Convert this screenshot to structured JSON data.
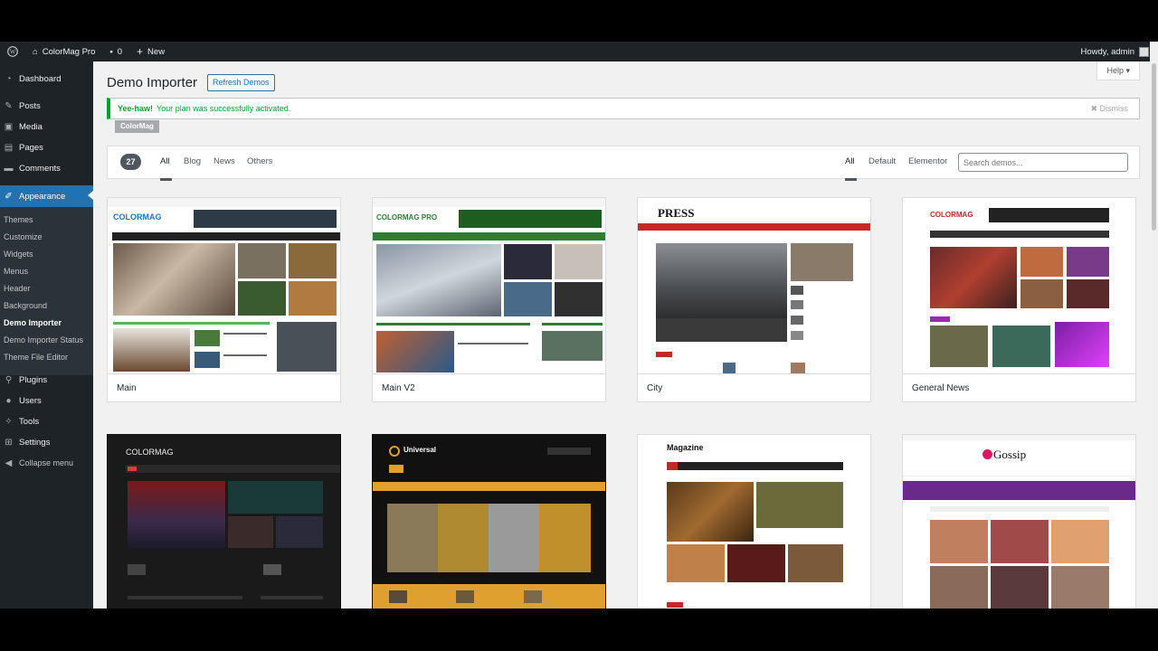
{
  "adminbar": {
    "site_name": "ColorMag Pro",
    "comments_count": "0",
    "new_label": "New",
    "greeting": "Howdy, admin"
  },
  "sidebar": {
    "items": [
      {
        "label": "Dashboard",
        "icon": "dashboard-icon"
      },
      {
        "label": "Posts",
        "icon": "pin-icon"
      },
      {
        "label": "Media",
        "icon": "media-icon"
      },
      {
        "label": "Pages",
        "icon": "pages-icon"
      },
      {
        "label": "Comments",
        "icon": "comment-icon"
      },
      {
        "label": "Appearance",
        "icon": "brush-icon"
      },
      {
        "label": "Plugins",
        "icon": "plugin-icon"
      },
      {
        "label": "Users",
        "icon": "users-icon"
      },
      {
        "label": "Tools",
        "icon": "wrench-icon"
      },
      {
        "label": "Settings",
        "icon": "settings-icon"
      },
      {
        "label": "Collapse menu",
        "icon": "collapse-icon"
      }
    ],
    "submenu": [
      "Themes",
      "Customize",
      "Widgets",
      "Menus",
      "Header",
      "Background",
      "Demo Importer",
      "Demo Importer Status",
      "Theme File Editor"
    ]
  },
  "header": {
    "title": "Demo Importer",
    "refresh_label": "Refresh Demos",
    "help_label": "Help ▾"
  },
  "notice": {
    "strong": "Yee-haw!",
    "text": "Your plan was successfully activated.",
    "dismiss": "Dismiss"
  },
  "plan_badge": "ColorMag",
  "filters": {
    "count": "27",
    "categories": [
      "All",
      "Blog",
      "News",
      "Others"
    ],
    "builders": [
      "All",
      "Default",
      "Elementor"
    ],
    "search_placeholder": "Search demos..."
  },
  "demos": [
    {
      "name": "Main",
      "logo": "COLORMAG"
    },
    {
      "name": "Main V2",
      "logo": "COLORMAG PRO"
    },
    {
      "name": "City",
      "logo": "PRESS"
    },
    {
      "name": "General News",
      "logo": "COLORMAG"
    },
    {
      "name": "",
      "logo": "COLORMAG"
    },
    {
      "name": "",
      "logo": "Universal"
    },
    {
      "name": "",
      "logo": "Magazine"
    },
    {
      "name": "",
      "logo": "Gossip"
    }
  ],
  "colors": {
    "wp_dark": "#1d2327",
    "wp_blue": "#2271b1",
    "success": "#00a32a"
  }
}
